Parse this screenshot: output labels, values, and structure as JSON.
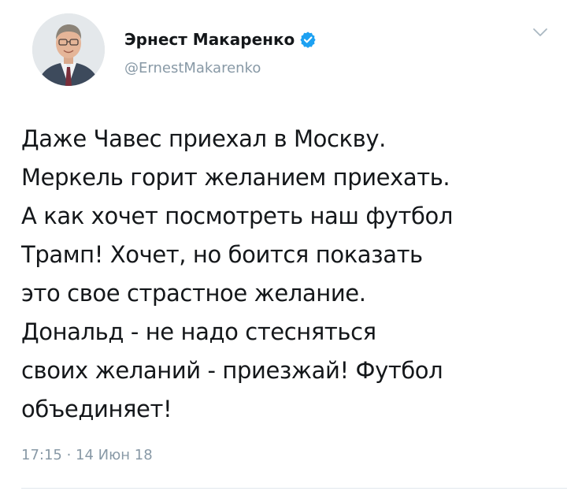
{
  "author": {
    "display_name": "Эрнест Макаренко",
    "handle": "@ErnestMakarenko",
    "verified": true
  },
  "tweet": {
    "lines": [
      "Даже Чавес приехал в Москву.",
      "Меркель горит желанием приехать.",
      "А как хочет посмотреть наш футбол",
      "Трамп! Хочет, но боится показать",
      "это свое страстное желание.",
      "Дональд - не надо стесняться",
      "своих желаний - приезжай! Футбол",
      "объединяет!"
    ],
    "timestamp": "17:15 · 14 Июн 18"
  },
  "icons": {
    "verified": "verified-badge-icon",
    "menu": "chevron-down-icon"
  },
  "colors": {
    "text": "#14171a",
    "secondary": "#8899a6",
    "verified": "#1da1f2",
    "divider": "#e1e8ed"
  }
}
